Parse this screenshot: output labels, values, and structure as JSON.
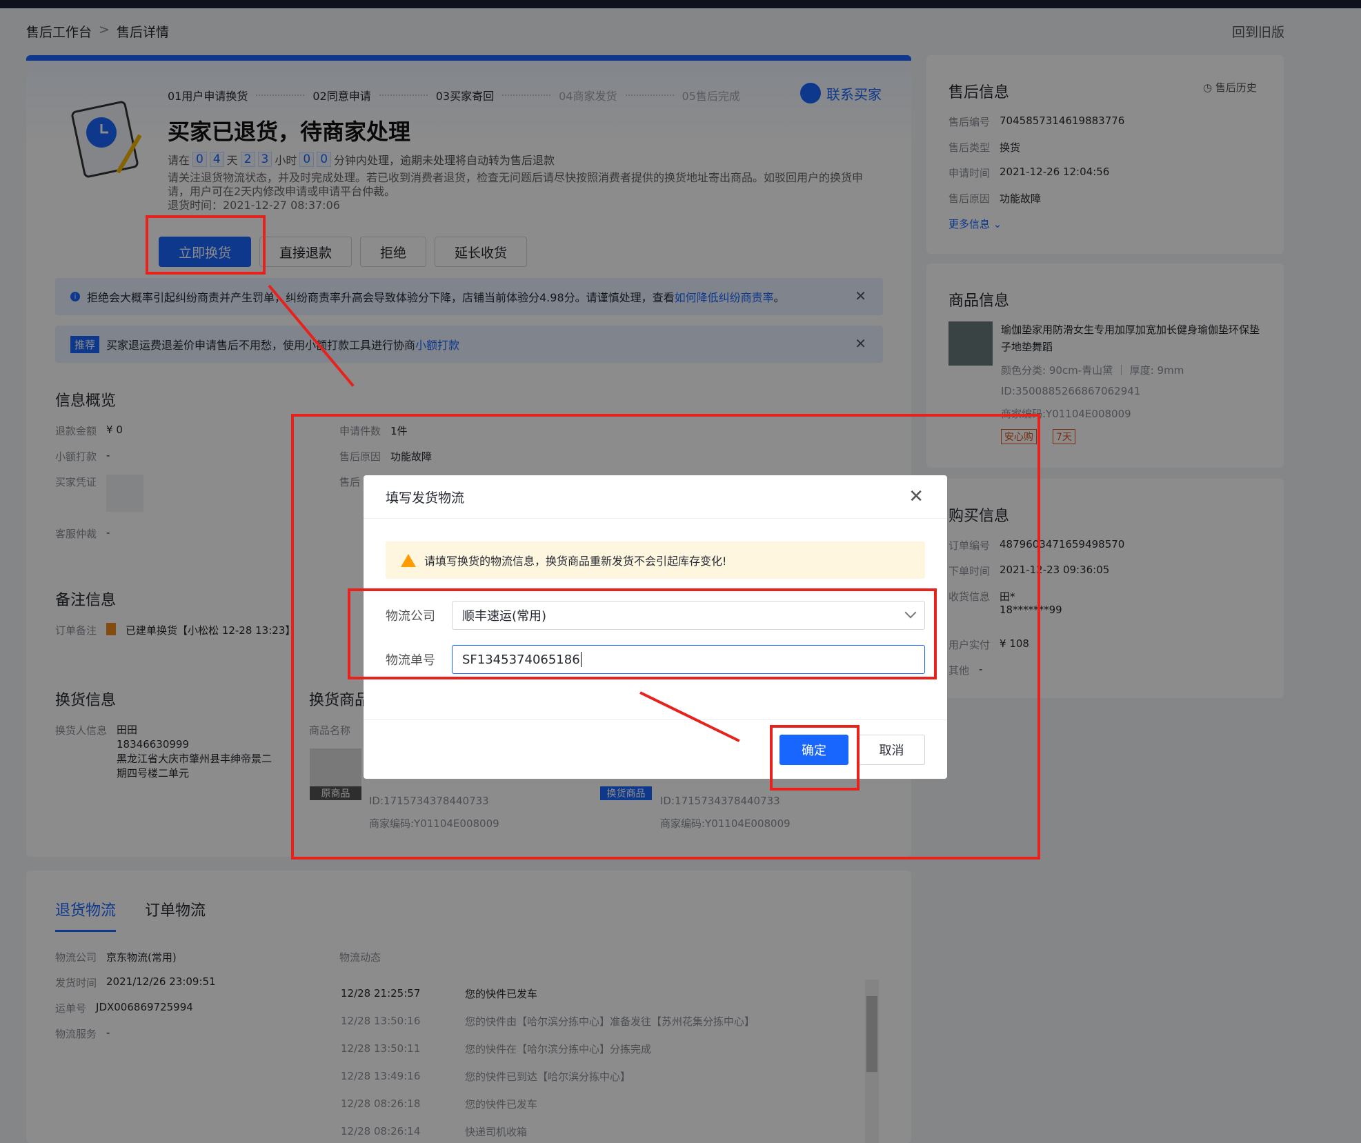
{
  "breadcrumb": {
    "home": "售后工作台",
    "sep": ">",
    "current": "售后详情"
  },
  "header": {
    "old_version": "回到旧版"
  },
  "steps": [
    "01用户申请换货",
    "02同意申请",
    "03买家寄回",
    "04商家发货",
    "05售后完成"
  ],
  "contact_buyer": "联系买家",
  "status": {
    "title": "买家已退货，待商家处理",
    "countdown_prefix": "请在",
    "d1": "0",
    "d2": "4",
    "unit_day": "天",
    "h1": "2",
    "h2": "3",
    "unit_hour": "小时",
    "m1": "0",
    "m2": "0",
    "countdown_suffix": "分钟内处理，逾期未处理将自动转为售后退款",
    "notice": "请关注退货物流状态，并及时完成处理。若已收到消费者退货，检查无问题后请尽快按照消费者提供的换货地址寄出商品。如驳回用户的换货申请，用户可在2天内修改申请或申请平台仲裁。",
    "return_time": "退货时间：2021-12-27 08:37:06"
  },
  "actions": {
    "exchange": "立即换货",
    "refund": "直接退款",
    "reject": "拒绝",
    "extend": "延长收货"
  },
  "banner1": {
    "text": "拒绝会大概率引起纠纷商责并产生罚单，纠纷商责率升高会导致体验分下降，店铺当前体验分4.98分。请谨慎处理，查看",
    "link": "如何降低纠纷商责率",
    "end": "。"
  },
  "banner2": {
    "tag": "推荐",
    "text": "买家退运费退差价申请售后不用愁，使用小额打款工具进行协商",
    "link": "小额打款"
  },
  "overview": {
    "title": "信息概览",
    "refund_amount_label": "退款金额",
    "refund_amount": "¥ 0",
    "small_pay_label": "小额打款",
    "small_pay": "-",
    "voucher_label": "买家凭证",
    "arbitration_label": "客服仲裁",
    "arbitration": "-",
    "count_label": "申请件数",
    "count": "1件",
    "reason_label": "售后原因",
    "reason": "功能故障",
    "third_label": "售后"
  },
  "remark": {
    "title": "备注信息",
    "label": "订单备注",
    "value": "已建单换货【小松松 12-28 13:23】"
  },
  "exchange_info": {
    "title": "换货信息",
    "label": "换货人信息",
    "name": "田田",
    "phone": "18346630999",
    "address": "黑龙江省大庆市肇州县丰绅帝景二期四号楼二单元"
  },
  "exchange_goods": {
    "title": "换货商品",
    "name_label": "商品名称",
    "orig_tag": "原商品",
    "new_tag": "换货商品",
    "id1": "ID:1715734378440733",
    "code1": "商家编码:Y01104E008009",
    "id2": "ID:1715734378440733",
    "code2": "商家编码:Y01104E008009"
  },
  "aftersale": {
    "title": "售后信息",
    "history": "售后历史",
    "no_label": "售后编号",
    "no": "7045857314619883776",
    "type_label": "售后类型",
    "type": "换货",
    "time_label": "申请时间",
    "time": "2021-12-26 12:04:56",
    "reason_label": "售后原因",
    "reason": "功能故障",
    "more": "更多信息"
  },
  "product": {
    "title": "商品信息",
    "name": "瑜伽垫家用防滑女生专用加厚加宽加长健身瑜伽垫环保垫子地垫舞蹈",
    "spec": "颜色分类: 90cm-青山黛 ｜ 厚度: 9mm",
    "id": "ID:3500885266867062941",
    "code": "商家编码:Y01104E008009",
    "tag1": "安心购",
    "tag2": "7天"
  },
  "purchase": {
    "title": "购买信息",
    "order_label": "订单编号",
    "order": "4879603471659498570",
    "time_label": "下单时间",
    "time": "2021-12-23 09:36:05",
    "recv_label": "收货信息",
    "recv1": "田*",
    "recv2": "18*******99",
    "paid_label": "用户实付",
    "paid": "¥ 108",
    "other_label": "其他",
    "other": "-"
  },
  "logistics": {
    "tab_return": "退货物流",
    "tab_order": "订单物流",
    "company_label": "物流公司",
    "company": "京东物流(常用)",
    "ship_label": "发货时间",
    "ship": "2021/12/26 23:09:51",
    "waybill_label": "运单号",
    "waybill": "JDX006869725994",
    "service_label": "物流服务",
    "service": "-",
    "dynamic_label": "物流动态",
    "events": [
      {
        "t": "12/28 21:25:57",
        "d": "您的快件已发车"
      },
      {
        "t": "12/28 13:50:16",
        "d": "您的快件由【哈尔滨分拣中心】准备发往【苏州花集分拣中心】"
      },
      {
        "t": "12/28 13:50:11",
        "d": "您的快件在【哈尔滨分拣中心】分拣完成"
      },
      {
        "t": "12/28 13:49:16",
        "d": "您的快件已到达【哈尔滨分拣中心】"
      },
      {
        "t": "12/28 08:26:18",
        "d": "您的快件已发车"
      },
      {
        "t": "12/28 08:26:14",
        "d": "快递司机收箱"
      }
    ]
  },
  "modal": {
    "title": "填写发货物流",
    "warning": "请填写换货的物流信息，换货商品重新发货不会引起库存变化!",
    "company_label": "物流公司",
    "company_value": "顺丰速运(常用)",
    "number_label": "物流单号",
    "number_value": "SF1345374065186",
    "ok": "确定",
    "cancel": "取消"
  }
}
